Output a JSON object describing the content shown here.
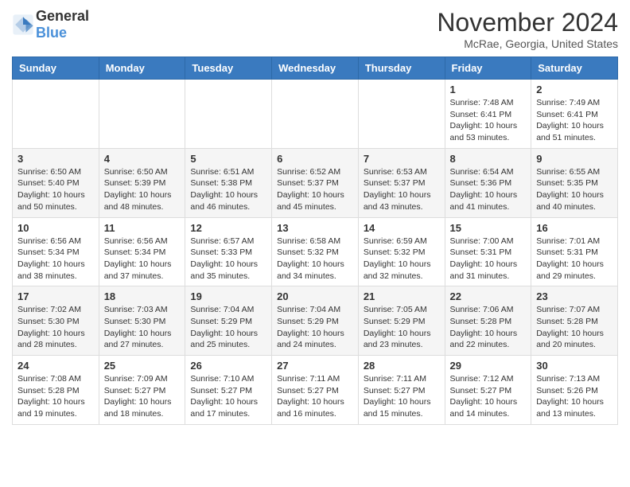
{
  "header": {
    "logo_general": "General",
    "logo_blue": "Blue",
    "month_title": "November 2024",
    "location": "McRae, Georgia, United States"
  },
  "weekdays": [
    "Sunday",
    "Monday",
    "Tuesday",
    "Wednesday",
    "Thursday",
    "Friday",
    "Saturday"
  ],
  "weeks": [
    {
      "days": [
        {
          "num": "",
          "info": ""
        },
        {
          "num": "",
          "info": ""
        },
        {
          "num": "",
          "info": ""
        },
        {
          "num": "",
          "info": ""
        },
        {
          "num": "",
          "info": ""
        },
        {
          "num": "1",
          "info": "Sunrise: 7:48 AM\nSunset: 6:41 PM\nDaylight: 10 hours\nand 53 minutes."
        },
        {
          "num": "2",
          "info": "Sunrise: 7:49 AM\nSunset: 6:41 PM\nDaylight: 10 hours\nand 51 minutes."
        }
      ]
    },
    {
      "days": [
        {
          "num": "3",
          "info": "Sunrise: 6:50 AM\nSunset: 5:40 PM\nDaylight: 10 hours\nand 50 minutes."
        },
        {
          "num": "4",
          "info": "Sunrise: 6:50 AM\nSunset: 5:39 PM\nDaylight: 10 hours\nand 48 minutes."
        },
        {
          "num": "5",
          "info": "Sunrise: 6:51 AM\nSunset: 5:38 PM\nDaylight: 10 hours\nand 46 minutes."
        },
        {
          "num": "6",
          "info": "Sunrise: 6:52 AM\nSunset: 5:37 PM\nDaylight: 10 hours\nand 45 minutes."
        },
        {
          "num": "7",
          "info": "Sunrise: 6:53 AM\nSunset: 5:37 PM\nDaylight: 10 hours\nand 43 minutes."
        },
        {
          "num": "8",
          "info": "Sunrise: 6:54 AM\nSunset: 5:36 PM\nDaylight: 10 hours\nand 41 minutes."
        },
        {
          "num": "9",
          "info": "Sunrise: 6:55 AM\nSunset: 5:35 PM\nDaylight: 10 hours\nand 40 minutes."
        }
      ]
    },
    {
      "days": [
        {
          "num": "10",
          "info": "Sunrise: 6:56 AM\nSunset: 5:34 PM\nDaylight: 10 hours\nand 38 minutes."
        },
        {
          "num": "11",
          "info": "Sunrise: 6:56 AM\nSunset: 5:34 PM\nDaylight: 10 hours\nand 37 minutes."
        },
        {
          "num": "12",
          "info": "Sunrise: 6:57 AM\nSunset: 5:33 PM\nDaylight: 10 hours\nand 35 minutes."
        },
        {
          "num": "13",
          "info": "Sunrise: 6:58 AM\nSunset: 5:32 PM\nDaylight: 10 hours\nand 34 minutes."
        },
        {
          "num": "14",
          "info": "Sunrise: 6:59 AM\nSunset: 5:32 PM\nDaylight: 10 hours\nand 32 minutes."
        },
        {
          "num": "15",
          "info": "Sunrise: 7:00 AM\nSunset: 5:31 PM\nDaylight: 10 hours\nand 31 minutes."
        },
        {
          "num": "16",
          "info": "Sunrise: 7:01 AM\nSunset: 5:31 PM\nDaylight: 10 hours\nand 29 minutes."
        }
      ]
    },
    {
      "days": [
        {
          "num": "17",
          "info": "Sunrise: 7:02 AM\nSunset: 5:30 PM\nDaylight: 10 hours\nand 28 minutes."
        },
        {
          "num": "18",
          "info": "Sunrise: 7:03 AM\nSunset: 5:30 PM\nDaylight: 10 hours\nand 27 minutes."
        },
        {
          "num": "19",
          "info": "Sunrise: 7:04 AM\nSunset: 5:29 PM\nDaylight: 10 hours\nand 25 minutes."
        },
        {
          "num": "20",
          "info": "Sunrise: 7:04 AM\nSunset: 5:29 PM\nDaylight: 10 hours\nand 24 minutes."
        },
        {
          "num": "21",
          "info": "Sunrise: 7:05 AM\nSunset: 5:29 PM\nDaylight: 10 hours\nand 23 minutes."
        },
        {
          "num": "22",
          "info": "Sunrise: 7:06 AM\nSunset: 5:28 PM\nDaylight: 10 hours\nand 22 minutes."
        },
        {
          "num": "23",
          "info": "Sunrise: 7:07 AM\nSunset: 5:28 PM\nDaylight: 10 hours\nand 20 minutes."
        }
      ]
    },
    {
      "days": [
        {
          "num": "24",
          "info": "Sunrise: 7:08 AM\nSunset: 5:28 PM\nDaylight: 10 hours\nand 19 minutes."
        },
        {
          "num": "25",
          "info": "Sunrise: 7:09 AM\nSunset: 5:27 PM\nDaylight: 10 hours\nand 18 minutes."
        },
        {
          "num": "26",
          "info": "Sunrise: 7:10 AM\nSunset: 5:27 PM\nDaylight: 10 hours\nand 17 minutes."
        },
        {
          "num": "27",
          "info": "Sunrise: 7:11 AM\nSunset: 5:27 PM\nDaylight: 10 hours\nand 16 minutes."
        },
        {
          "num": "28",
          "info": "Sunrise: 7:11 AM\nSunset: 5:27 PM\nDaylight: 10 hours\nand 15 minutes."
        },
        {
          "num": "29",
          "info": "Sunrise: 7:12 AM\nSunset: 5:27 PM\nDaylight: 10 hours\nand 14 minutes."
        },
        {
          "num": "30",
          "info": "Sunrise: 7:13 AM\nSunset: 5:26 PM\nDaylight: 10 hours\nand 13 minutes."
        }
      ]
    }
  ]
}
